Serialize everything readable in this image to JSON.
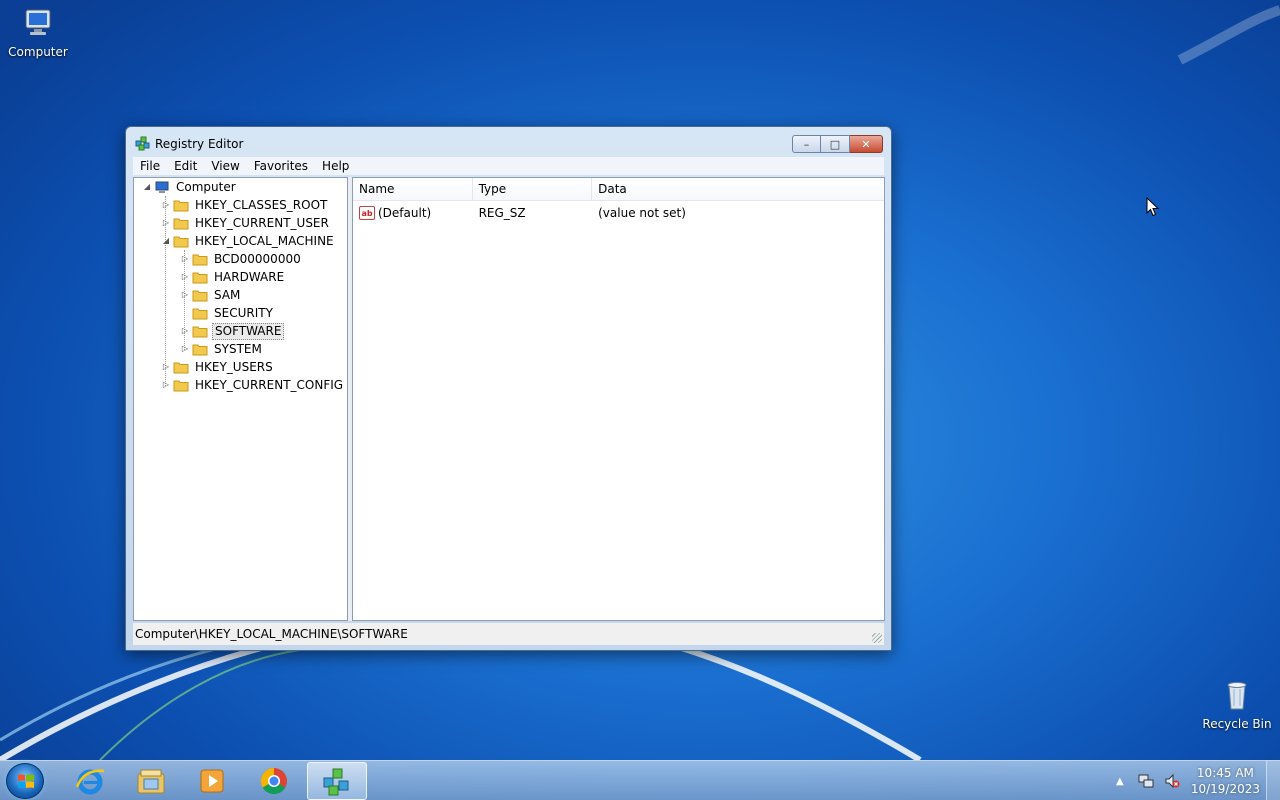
{
  "desktop": {
    "icons": [
      {
        "label": "Computer"
      },
      {
        "label": "Recycle Bin"
      }
    ]
  },
  "window": {
    "title": "Registry Editor",
    "controls": {
      "minimize": "–",
      "maximize": "□",
      "close": "✕"
    },
    "menu": [
      "File",
      "Edit",
      "View",
      "Favorites",
      "Help"
    ],
    "tree": {
      "root": "Computer",
      "hives": [
        "HKEY_CLASSES_ROOT",
        "HKEY_CURRENT_USER",
        "HKEY_LOCAL_MACHINE",
        "HKEY_USERS",
        "HKEY_CURRENT_CONFIG"
      ],
      "hklm_children": [
        "BCD00000000",
        "HARDWARE",
        "SAM",
        "SECURITY",
        "SOFTWARE",
        "SYSTEM"
      ],
      "selected": "SOFTWARE"
    },
    "list": {
      "columns": [
        "Name",
        "Type",
        "Data"
      ],
      "rows": [
        {
          "icon": "string-value-icon",
          "icon_text": "ab",
          "name": "(Default)",
          "type": "REG_SZ",
          "data": "(value not set)"
        }
      ]
    },
    "status_path": "Computer\\HKEY_LOCAL_MACHINE\\SOFTWARE"
  },
  "taskbar": {
    "items": [
      "internet-explorer-icon",
      "file-explorer-icon",
      "media-player-icon",
      "chrome-icon",
      "registry-editor-icon"
    ],
    "active_item": "registry-editor-icon",
    "tray": {
      "time": "10:45 AM",
      "date": "10/19/2023"
    }
  },
  "colors": {
    "desktop_blue": "#1a6fd0",
    "folder_yellow": "#f2c94c",
    "close_red": "#c74c32"
  }
}
